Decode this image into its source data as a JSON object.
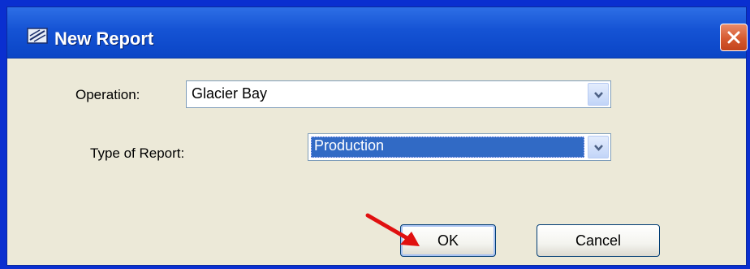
{
  "window": {
    "title": "New Report",
    "icons": {
      "app": "report-app-icon",
      "close": "close-icon"
    }
  },
  "form": {
    "operation": {
      "label": "Operation:",
      "value": "Glacier Bay"
    },
    "report_type": {
      "label": "Type of Report:",
      "value": "Production"
    }
  },
  "buttons": {
    "ok": "OK",
    "cancel": "Cancel"
  },
  "colors": {
    "title_bar": "#1553d4",
    "window_bg": "#ece9d8",
    "selection": "#316ac5",
    "annotation_arrow": "#e01010"
  }
}
